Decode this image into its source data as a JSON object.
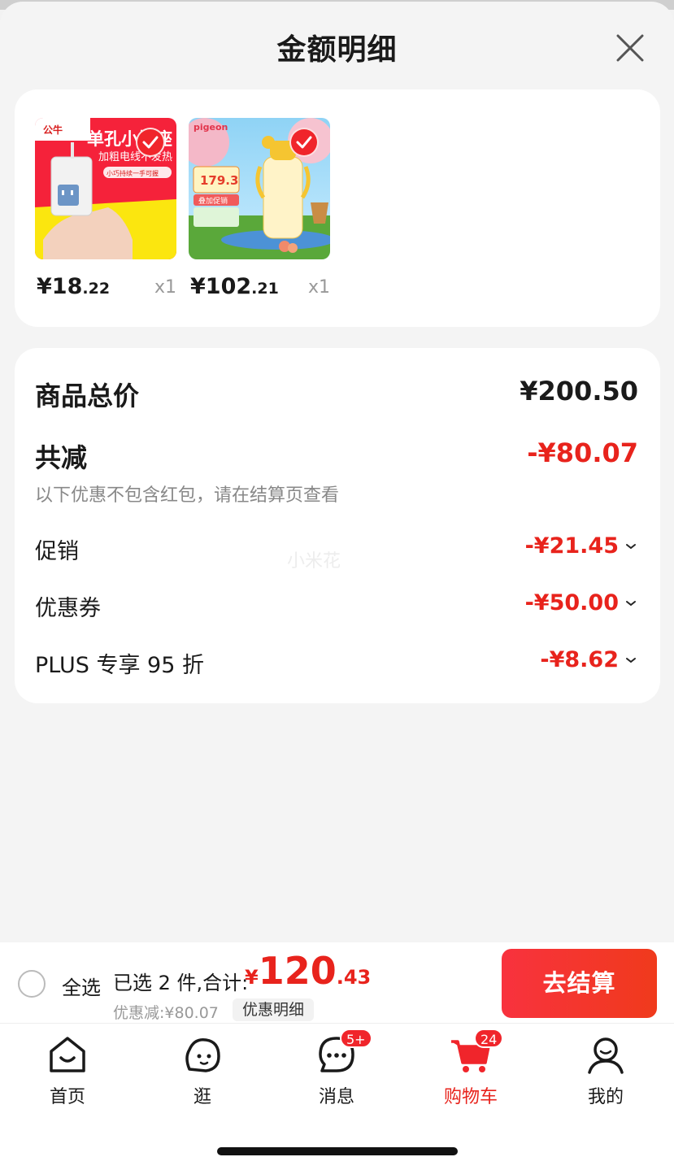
{
  "sheet": {
    "title": "金额明细"
  },
  "products": [
    {
      "price_int": "¥18",
      "price_dec": ".22",
      "qty": "x1",
      "brand": "公牛",
      "banner": "单孔小插座",
      "subtitle": "加粗电线不发热",
      "tag": "小巧持续一手可握"
    },
    {
      "price_int": "¥102",
      "price_dec": ".21",
      "qty": "x1",
      "brand": "pigeon",
      "promo_price": "179.3",
      "promo_label": "叠加促销"
    }
  ],
  "summary": {
    "total_label": "商品总价",
    "total_value": "¥200.50",
    "reduce_label": "共减",
    "reduce_value": "-¥80.07",
    "note": "以下优惠不包含红包，请在结算页查看",
    "items": [
      {
        "label": "促销",
        "value": "-¥21.45"
      },
      {
        "label": "优惠券",
        "value": "-¥50.00"
      },
      {
        "label": "PLUS 专享 95 折",
        "value": "-¥8.62"
      }
    ],
    "watermark": "小米花"
  },
  "checkout": {
    "select_all": "全选",
    "selected_text": "已选 2 件,合计:",
    "total_currency": "¥",
    "total_int": "120",
    "total_dec": ".43",
    "discount_line": "优惠减:¥80.07",
    "detail_button": "优惠明细",
    "checkout_button": "去结算"
  },
  "tabs": [
    {
      "label": "首页",
      "icon": "home-icon"
    },
    {
      "label": "逛",
      "icon": "browse-icon"
    },
    {
      "label": "消息",
      "icon": "message-icon",
      "badge": "5+"
    },
    {
      "label": "购物车",
      "icon": "cart-icon",
      "badge": "24",
      "active": true
    },
    {
      "label": "我的",
      "icon": "profile-icon"
    }
  ],
  "colors": {
    "accent": "#e8231c",
    "background": "#f4f4f4"
  }
}
